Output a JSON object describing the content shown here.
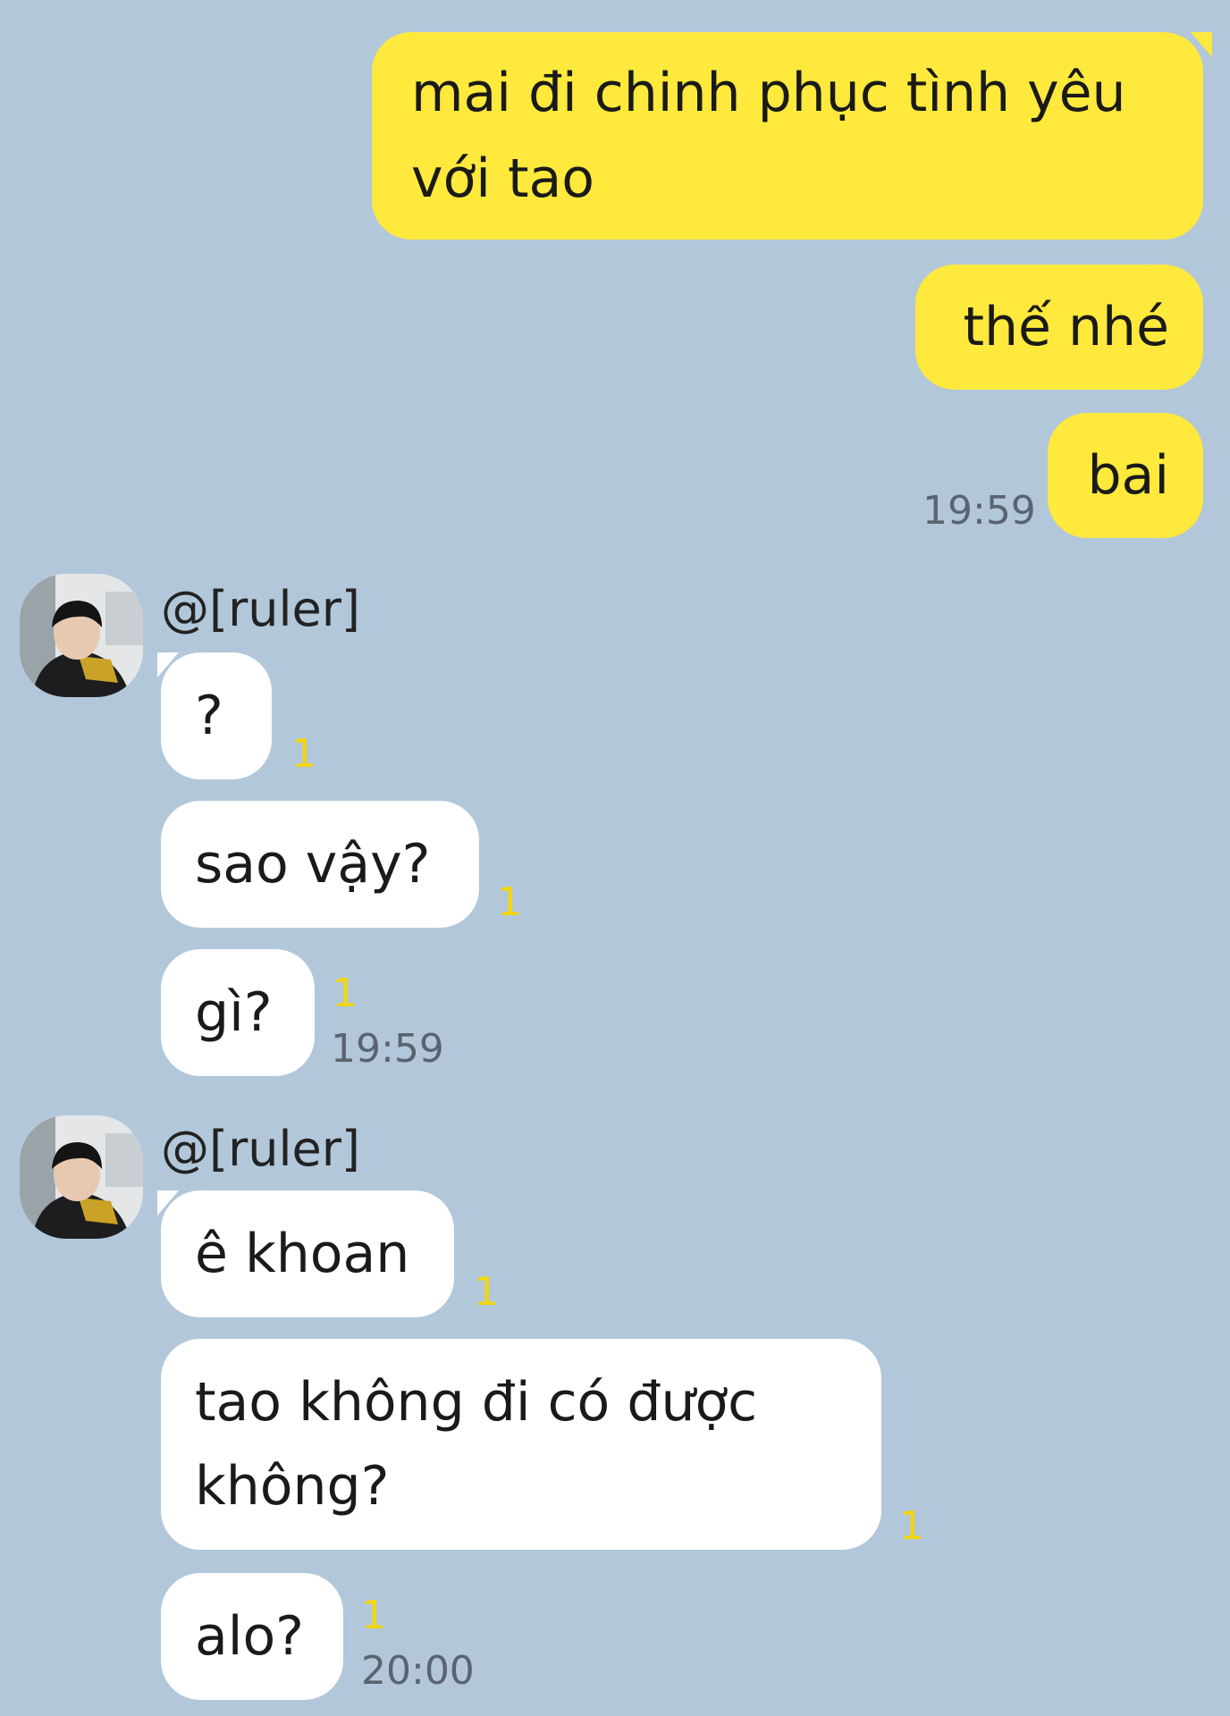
{
  "colors": {
    "background": "#b2c7da",
    "sent_bubble": "#fee93c",
    "received_bubble": "#ffffff",
    "unread_count": "#f4d60e"
  },
  "messages_sent": [
    {
      "text": "mai đi chinh phục tình yêu với tao"
    },
    {
      "text": "thế nhé"
    },
    {
      "text": "bai",
      "time": "19:59"
    }
  ],
  "groups": [
    {
      "sender": "@[ruler]",
      "avatar": "profile-photo",
      "messages": [
        {
          "text": "?",
          "unread": "1"
        },
        {
          "text": "sao vậy?",
          "unread": "1"
        },
        {
          "text": "gì?",
          "unread": "1",
          "time": "19:59"
        }
      ]
    },
    {
      "sender": "@[ruler]",
      "avatar": "profile-photo",
      "messages": [
        {
          "text": "ê khoan",
          "unread": "1"
        },
        {
          "text": "tao không đi có được không?",
          "unread": "1"
        },
        {
          "text": "alo?",
          "unread": "1",
          "time": "20:00"
        }
      ]
    }
  ]
}
